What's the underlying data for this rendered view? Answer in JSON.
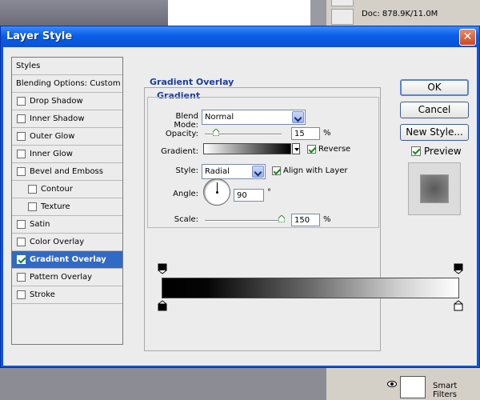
{
  "background": {
    "doc_info": "Doc: 878.9K/11.0M",
    "smart_filters_label": "Smart Filters"
  },
  "dialog": {
    "title": "Layer Style",
    "close_glyph": "✕"
  },
  "styles_list": [
    {
      "label": "Styles",
      "type": "header",
      "checked": false
    },
    {
      "label": "Blending Options: Custom",
      "type": "header",
      "checked": false
    },
    {
      "label": "Drop Shadow",
      "type": "item",
      "checked": false
    },
    {
      "label": "Inner Shadow",
      "type": "item",
      "checked": false
    },
    {
      "label": "Outer Glow",
      "type": "item",
      "checked": false
    },
    {
      "label": "Inner Glow",
      "type": "item",
      "checked": false
    },
    {
      "label": "Bevel and Emboss",
      "type": "item",
      "checked": false
    },
    {
      "label": "Contour",
      "type": "sub",
      "checked": false
    },
    {
      "label": "Texture",
      "type": "sub",
      "checked": false
    },
    {
      "label": "Satin",
      "type": "item",
      "checked": false
    },
    {
      "label": "Color Overlay",
      "type": "item",
      "checked": false
    },
    {
      "label": "Gradient Overlay",
      "type": "item",
      "checked": true,
      "selected": true
    },
    {
      "label": "Pattern Overlay",
      "type": "item",
      "checked": false
    },
    {
      "label": "Stroke",
      "type": "item",
      "checked": false
    }
  ],
  "panel": {
    "group_title": "Gradient Overlay",
    "sub_title": "Gradient",
    "blend_mode_label": "Blend Mode:",
    "blend_mode_value": "Normal",
    "opacity_label": "Opacity:",
    "opacity_value": "15",
    "opacity_fraction": 0.15,
    "gradient_label": "Gradient:",
    "reverse_label": "Reverse",
    "reverse_checked": true,
    "style_label": "Style:",
    "style_value": "Radial",
    "align_label": "Align with Layer",
    "align_checked": true,
    "angle_label": "Angle:",
    "angle_value": "90",
    "degree_symbol": "°",
    "scale_label": "Scale:",
    "scale_value": "150",
    "scale_fraction": 1.0,
    "percent": "%"
  },
  "buttons": {
    "ok": "OK",
    "cancel": "Cancel",
    "new_style": "New Style...",
    "preview_label": "Preview",
    "preview_checked": true
  },
  "colors": {
    "title_blue": "#0a54e3",
    "selection_blue": "#316ac5",
    "heading_blue": "#1c3c9c"
  }
}
